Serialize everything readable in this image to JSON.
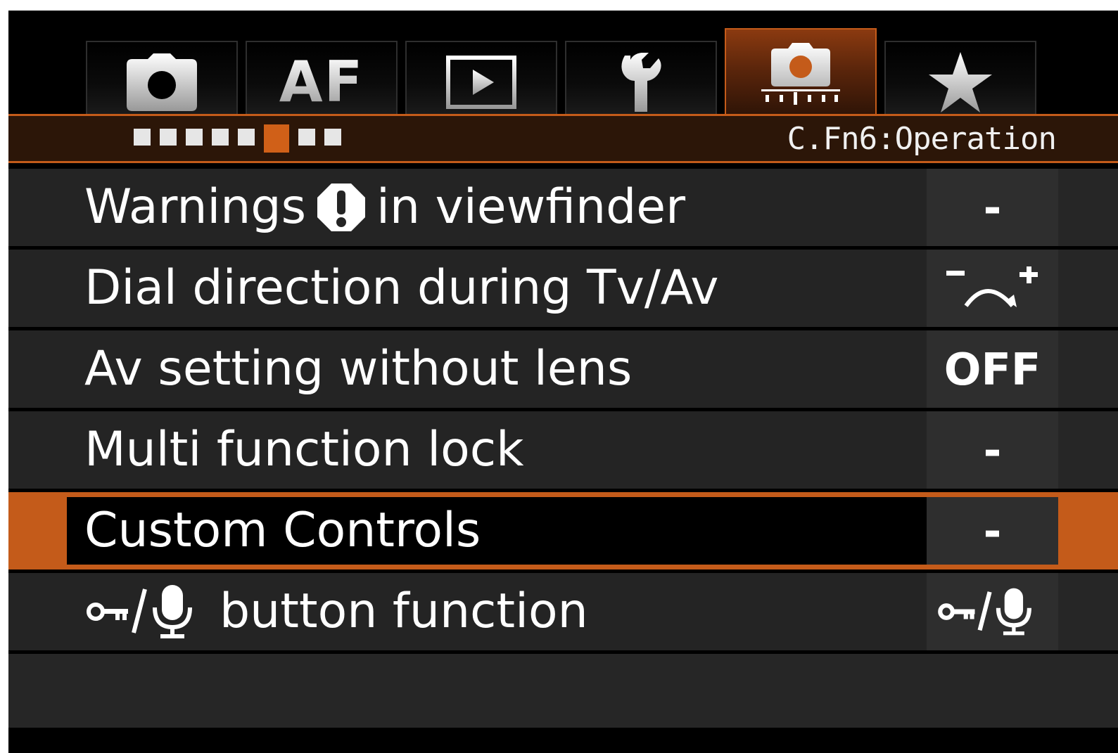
{
  "tabs": [
    {
      "id": "shooting",
      "icon": "camera-icon",
      "label": ""
    },
    {
      "id": "af",
      "icon": "",
      "label": "AF"
    },
    {
      "id": "playback",
      "icon": "playback-icon",
      "label": ""
    },
    {
      "id": "setup",
      "icon": "wrench-icon",
      "label": ""
    },
    {
      "id": "custom-functions",
      "icon": "custom-function-camera-icon",
      "label": "",
      "active": true
    },
    {
      "id": "my-menu",
      "icon": "star-icon",
      "label": ""
    }
  ],
  "header": {
    "title": "C.Fn6:Operation",
    "page_count": 8,
    "current_page": 6
  },
  "menu_items": [
    {
      "label_before_icon": "Warnings",
      "label_after_icon": "in viewfinder",
      "inline_icon": "warning-icon",
      "value": "-"
    },
    {
      "label": "Dial direction during Tv/Av",
      "value_icon": "dial-direction-icon",
      "value": ""
    },
    {
      "label": "Av setting without lens",
      "value": "OFF"
    },
    {
      "label": "Multi function lock",
      "value": "-"
    },
    {
      "label": "Custom Controls",
      "value": "-",
      "selected": true
    },
    {
      "label_icon": "lock-mic-icon",
      "label": "button function",
      "value_icon": "lock-mic-icon",
      "value": ""
    }
  ],
  "colors": {
    "accent": "#c45b1a",
    "row_background": "#242424",
    "value_background": "#2e2e2e"
  }
}
